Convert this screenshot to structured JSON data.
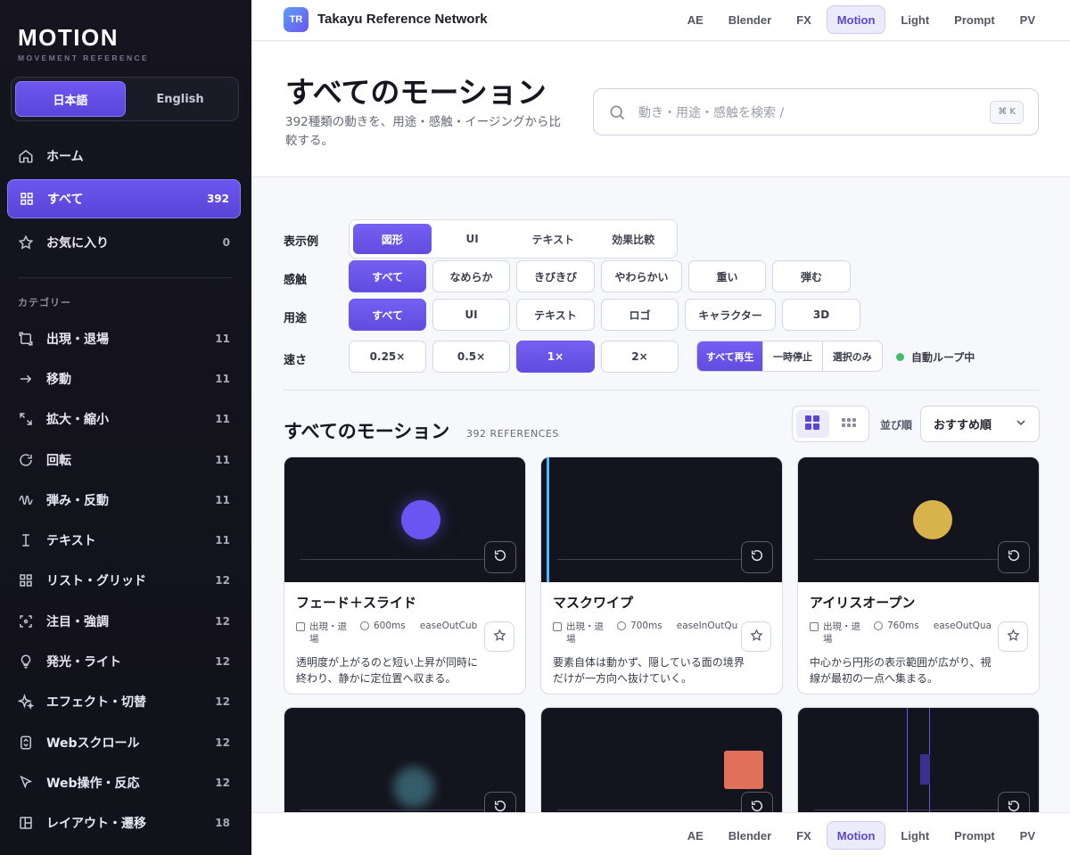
{
  "sidebar": {
    "logo": "MOTION",
    "logo_sub": "MOVEMENT REFERENCE",
    "lang": [
      "日本語",
      "English"
    ],
    "top_items": [
      {
        "label": "ホーム",
        "count": ""
      },
      {
        "label": "すべて",
        "count": "392"
      },
      {
        "label": "お気に入り",
        "count": "0"
      }
    ],
    "category_heading": "カテゴリー",
    "categories": [
      {
        "label": "出現・退場",
        "count": "11"
      },
      {
        "label": "移動",
        "count": "11"
      },
      {
        "label": "拡大・縮小",
        "count": "11"
      },
      {
        "label": "回転",
        "count": "11"
      },
      {
        "label": "弾み・反動",
        "count": "11"
      },
      {
        "label": "テキスト",
        "count": "11"
      },
      {
        "label": "リスト・グリッド",
        "count": "12"
      },
      {
        "label": "注目・強調",
        "count": "12"
      },
      {
        "label": "発光・ライト",
        "count": "12"
      },
      {
        "label": "エフェクト・切替",
        "count": "12"
      },
      {
        "label": "Webスクロール",
        "count": "12"
      },
      {
        "label": "Web操作・反応",
        "count": "12"
      },
      {
        "label": "レイアウト・遷移",
        "count": "18"
      }
    ]
  },
  "topbar": {
    "brand_icon": "TR",
    "brand_name": "Takayu Reference Network",
    "tabs": [
      "AE",
      "Blender",
      "FX",
      "Motion",
      "Light",
      "Prompt",
      "PV"
    ],
    "active_tab": "Motion"
  },
  "header": {
    "title": "すべてのモーション",
    "desc": "392種類の動きを、用途・感触・イージングから比較する。",
    "search_placeholder": "動き・用途・感触を検索  /",
    "search_kbd": "⌘ K"
  },
  "filters": {
    "display_label": "表示例",
    "display_options": [
      "図形",
      "UI",
      "テキスト",
      "効果比較"
    ],
    "feel_label": "感触",
    "feel_options": [
      "すべて",
      "なめらか",
      "きびきび",
      "やわらかい",
      "重い",
      "弾む"
    ],
    "use_label": "用途",
    "use_options": [
      "すべて",
      "UI",
      "テキスト",
      "ロゴ",
      "キャラクター",
      "3D"
    ],
    "speed_label": "速さ",
    "speed_options": [
      "0.25×",
      "0.5×",
      "1×",
      "2×"
    ],
    "play_options": [
      "すべて再生",
      "一時停止",
      "選択のみ"
    ],
    "auto_loop": "自動ループ中"
  },
  "listing": {
    "title": "すべてのモーション",
    "count": "392 REFERENCES",
    "sort_label": "並び順",
    "sort_value": "おすすめ順"
  },
  "cards": [
    {
      "title": "フェード＋スライド",
      "category": "出現・退場",
      "duration": "600ms",
      "easing": "easeOutCub",
      "desc": "透明度が上がるのと短い上昇が同時に終わり、静かに定位置へ収まる。"
    },
    {
      "title": "マスクワイプ",
      "category": "出現・退場",
      "duration": "700ms",
      "easing": "easeInOutQu",
      "desc": "要素自体は動かず、隠している面の境界だけが一方向へ抜けていく。"
    },
    {
      "title": "アイリスオープン",
      "category": "出現・退場",
      "duration": "760ms",
      "easing": "easeOutQua",
      "desc": "中心から円形の表示範囲が広がり、視線が最初の一点へ集まる。"
    }
  ],
  "bottombar": {
    "tabs": [
      "AE",
      "Blender",
      "FX",
      "Motion",
      "Light",
      "Prompt",
      "PV"
    ],
    "active_tab": "Motion"
  },
  "colors": {
    "accent": "#6c55ee",
    "sidebar_bg": "#15141f",
    "preview_bg": "#13141d",
    "circle_purple": "#6a55f2",
    "circle_gold": "#d8b24a",
    "wipe_line": "#4cb8ff",
    "square_coral": "#e0705a",
    "auto_dot": "#3fbf6b"
  }
}
